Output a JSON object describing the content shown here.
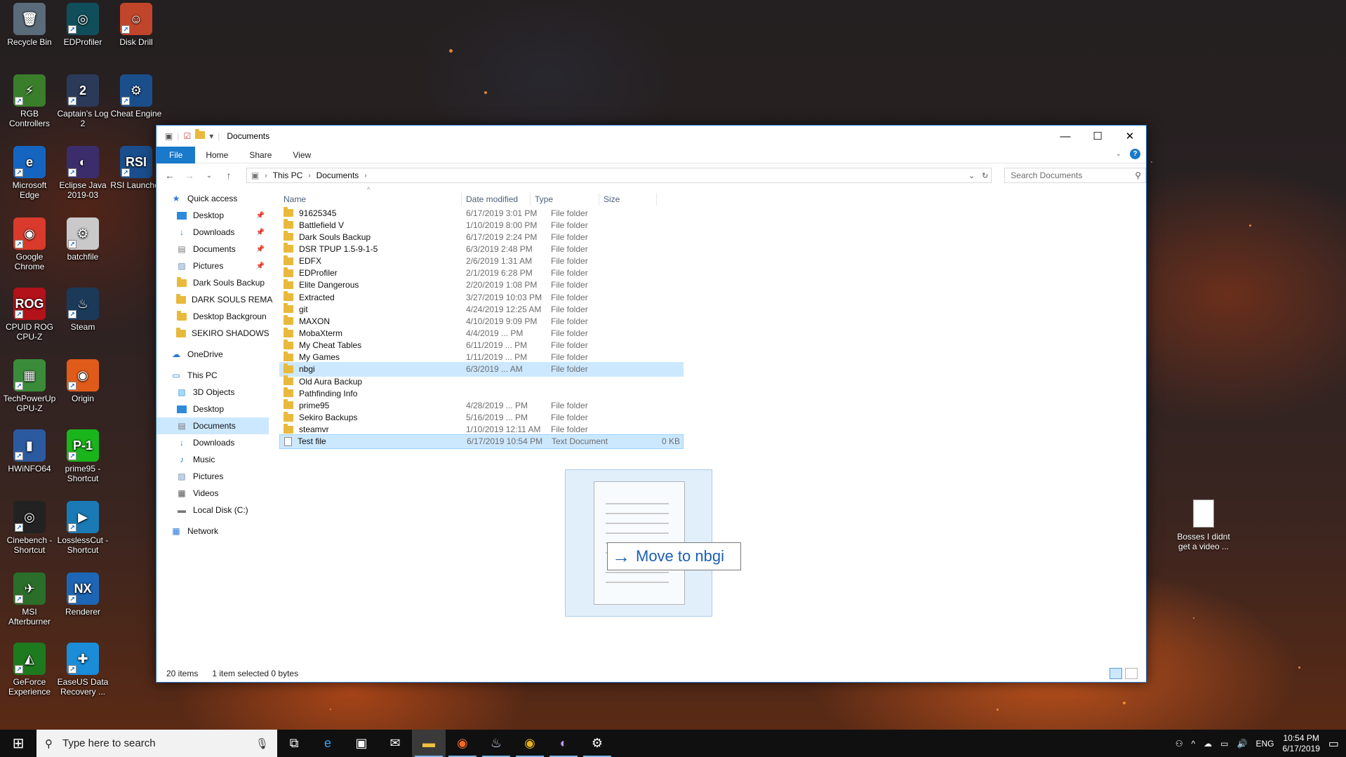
{
  "desktop": {
    "icons": [
      {
        "label": "Recycle Bin",
        "glyph": "🗑",
        "bg": "#5a6b7a"
      },
      {
        "label": "EDProfiler",
        "glyph": "◎",
        "bg": "#0f4e5a"
      },
      {
        "label": "Disk Drill",
        "glyph": "☺",
        "bg": "#c0452a"
      },
      {
        "label": "RGB Controllers",
        "glyph": "⚡",
        "bg": "#3a7d2a"
      },
      {
        "label": "Captain's Log 2",
        "glyph": "2",
        "bg": "#2c3a5a"
      },
      {
        "label": "Cheat Engine",
        "glyph": "⚙",
        "bg": "#1b4f8c"
      },
      {
        "label": "Microsoft Edge",
        "glyph": "e",
        "bg": "#1565c0"
      },
      {
        "label": "Eclipse Java 2019-03",
        "glyph": "◐",
        "bg": "#3b2d6b"
      },
      {
        "label": "RSI Launcher",
        "glyph": "RSI",
        "bg": "#1a4e8c"
      },
      {
        "label": "Google Chrome",
        "glyph": "◉",
        "bg": "#d93a2b"
      },
      {
        "label": "batchfile",
        "glyph": "⚙",
        "bg": "#c9c9c9"
      },
      {
        "label": "CPUID ROG CPU-Z",
        "glyph": "ROG",
        "bg": "#b3121a"
      },
      {
        "label": "Steam",
        "glyph": "♨",
        "bg": "#1b3a5a"
      },
      {
        "label": "TechPowerUp GPU-Z",
        "glyph": "▦",
        "bg": "#3b8c3a"
      },
      {
        "label": "Origin",
        "glyph": "◉",
        "bg": "#e05a1a"
      },
      {
        "label": "HWiNFO64",
        "glyph": "▮",
        "bg": "#2c5aa0"
      },
      {
        "label": "prime95 - Shortcut",
        "glyph": "P-1",
        "bg": "#1ab51a"
      },
      {
        "label": "Cinebench - Shortcut",
        "glyph": "◎",
        "bg": "#222"
      },
      {
        "label": "LosslessCut - Shortcut",
        "glyph": "▶",
        "bg": "#1a7ab5"
      },
      {
        "label": "MSI Afterburner",
        "glyph": "✈",
        "bg": "#2a6e2a"
      },
      {
        "label": "Renderer",
        "glyph": "NX",
        "bg": "#1c66b5"
      },
      {
        "label": "GeForce Experience",
        "glyph": "◭",
        "bg": "#1e7a1e"
      },
      {
        "label": "EaseUS Data Recovery ...",
        "glyph": "✚",
        "bg": "#1a8cd8"
      }
    ],
    "right_file": {
      "label": "Bosses I didnt get a video ..."
    }
  },
  "window": {
    "title": "Documents",
    "quick_access_icons": [
      "save-icon",
      "properties-icon",
      "new-folder-icon",
      "customize-icon"
    ],
    "ribbon_tabs": [
      "File",
      "Home",
      "Share",
      "View"
    ],
    "help_label": "?",
    "address": {
      "crumbs": [
        "This PC",
        "Documents"
      ]
    },
    "search_placeholder": "Search Documents",
    "columns": {
      "name": "Name",
      "date": "Date modified",
      "type": "Type",
      "size": "Size"
    },
    "nav": {
      "quick_access": "Quick access",
      "pinned": [
        "Desktop",
        "Downloads",
        "Documents",
        "Pictures"
      ],
      "recent": [
        "Dark Souls Backup",
        "DARK SOULS REMA",
        "Desktop Backgroun",
        "SEKIRO  SHADOWS"
      ],
      "onedrive": "OneDrive",
      "this_pc": "This PC",
      "pc_items": [
        "3D Objects",
        "Desktop",
        "Documents",
        "Downloads",
        "Music",
        "Pictures",
        "Videos",
        "Local Disk (C:)"
      ],
      "network": "Network"
    },
    "files": [
      {
        "name": "91625345",
        "date": "6/17/2019 3:01 PM",
        "type": "File folder",
        "size": ""
      },
      {
        "name": "Battlefield V",
        "date": "1/10/2019 8:00 PM",
        "type": "File folder",
        "size": ""
      },
      {
        "name": "Dark Souls Backup",
        "date": "6/17/2019 2:24 PM",
        "type": "File folder",
        "size": ""
      },
      {
        "name": "DSR TPUP 1.5-9-1-5",
        "date": "6/3/2019 2:48 PM",
        "type": "File folder",
        "size": ""
      },
      {
        "name": "EDFX",
        "date": "2/6/2019 1:31 AM",
        "type": "File folder",
        "size": ""
      },
      {
        "name": "EDProfiler",
        "date": "2/1/2019 6:28 PM",
        "type": "File folder",
        "size": ""
      },
      {
        "name": "Elite Dangerous",
        "date": "2/20/2019 1:08 PM",
        "type": "File folder",
        "size": ""
      },
      {
        "name": "Extracted",
        "date": "3/27/2019 10:03 PM",
        "type": "File folder",
        "size": ""
      },
      {
        "name": "git",
        "date": "4/24/2019 12:25 AM",
        "type": "File folder",
        "size": ""
      },
      {
        "name": "MAXON",
        "date": "4/10/2019 9:09 PM",
        "type": "File folder",
        "size": ""
      },
      {
        "name": "MobaXterm",
        "date": "4/4/2019 ... PM",
        "type": "File folder",
        "size": ""
      },
      {
        "name": "My Cheat Tables",
        "date": "6/11/2019 ... PM",
        "type": "File folder",
        "size": ""
      },
      {
        "name": "My Games",
        "date": "1/11/2019 ... PM",
        "type": "File folder",
        "size": ""
      },
      {
        "name": "nbgi",
        "date": "6/3/2019 ... AM",
        "type": "File folder",
        "size": ""
      },
      {
        "name": "Old Aura Backup",
        "date": "",
        "type": "",
        "size": ""
      },
      {
        "name": "Pathfinding Info",
        "date": "",
        "type": "",
        "size": ""
      },
      {
        "name": "prime95",
        "date": "4/28/2019 ... PM",
        "type": "File folder",
        "size": ""
      },
      {
        "name": "Sekiro Backups",
        "date": "5/16/2019 ... PM",
        "type": "File folder",
        "size": ""
      },
      {
        "name": "steamvr",
        "date": "1/10/2019 12:11 AM",
        "type": "File folder",
        "size": ""
      },
      {
        "name": "Test file",
        "date": "6/17/2019 10:54 PM",
        "type": "Text Document",
        "size": "0 KB"
      }
    ],
    "drag_tooltip": "Move to nbgi",
    "status": {
      "count": "20 items",
      "selection": "1 item selected  0 bytes"
    }
  },
  "taskbar": {
    "search_placeholder": "Type here to search",
    "apps": [
      "task-view-icon",
      "edge-icon",
      "store-icon",
      "mail-icon",
      "file-explorer-icon",
      "origin-icon",
      "steam-icon",
      "chrome-icon",
      "eclipse-icon",
      "settings-icon"
    ],
    "lang": "ENG",
    "time": "10:54 PM",
    "date": "6/17/2019"
  }
}
